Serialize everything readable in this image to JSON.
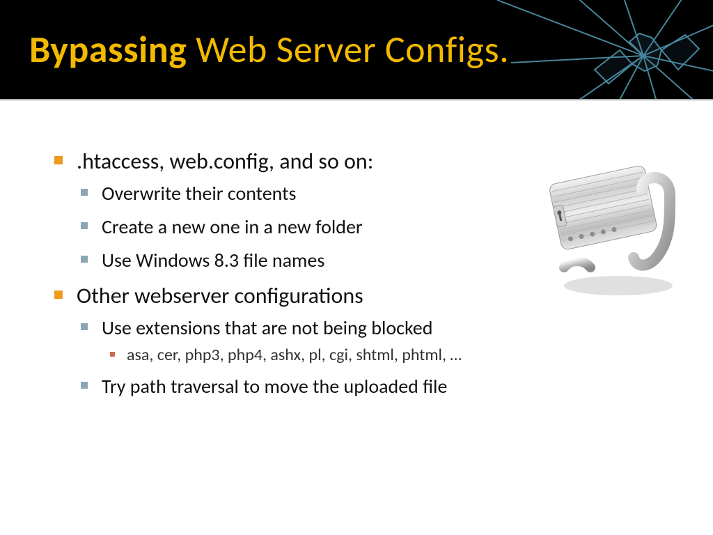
{
  "header": {
    "title_accent": "Bypassing",
    "title_rest": " Web Server Configs."
  },
  "bullets": {
    "item1": {
      "text": ".htaccess, web.config, and so on:",
      "sub": {
        "a": "Overwrite their contents",
        "b": "Create a new one in a new folder",
        "c": "Use Windows 8.3 file names"
      }
    },
    "item2": {
      "text": "Other webserver configurations",
      "sub": {
        "a": "Use extensions that are not being blocked",
        "a_sub": "asa, cer, php3, php4, ashx, pl, cgi, shtml, phtml, …",
        "b": "Try path traversal to move the uploaded file"
      }
    }
  }
}
